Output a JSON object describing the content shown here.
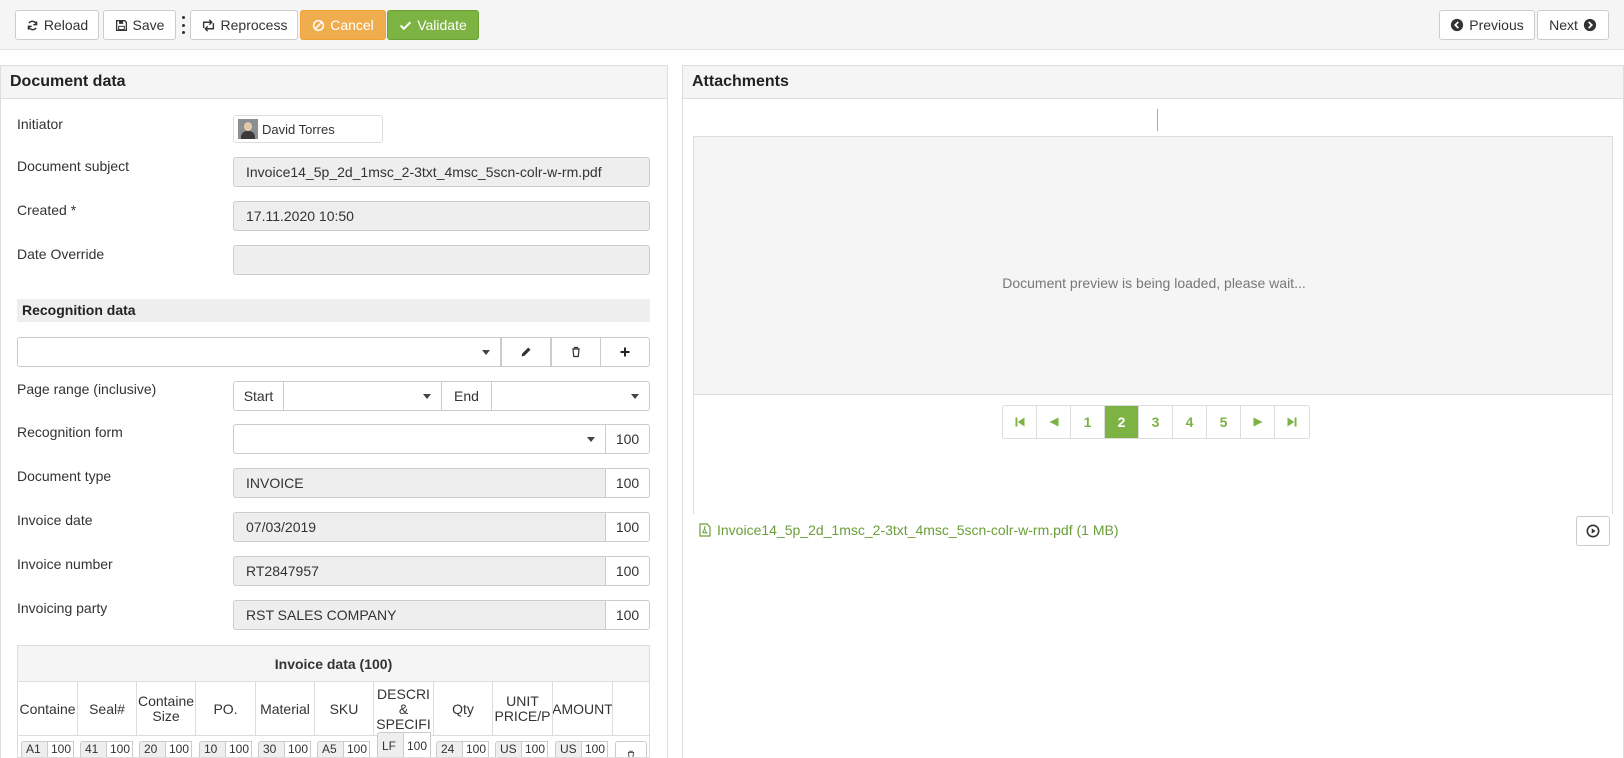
{
  "toolbar": {
    "reload": "Reload",
    "save": "Save",
    "reprocess": "Reprocess",
    "cancel": "Cancel",
    "validate": "Validate",
    "previous": "Previous",
    "next": "Next"
  },
  "document_data": {
    "title": "Document data",
    "initiator_label": "Initiator",
    "initiator": "David Torres",
    "subject_label": "Document subject",
    "subject": "Invoice14_5p_2d_1msc_2-3txt_4msc_5scn-colr-w-rm.pdf",
    "created_label": "Created",
    "created_required": "*",
    "created": "17.11.2020 10:50",
    "date_override_label": "Date Override",
    "date_override": ""
  },
  "recognition": {
    "title": "Recognition data",
    "page_range_label": "Page range (inclusive)",
    "start": "Start",
    "end": "End",
    "form_label": "Recognition form",
    "form_score": "100",
    "fields": [
      {
        "label": "Document type",
        "value": "INVOICE",
        "score": "100"
      },
      {
        "label": "Invoice date",
        "value": "07/03/2019",
        "score": "100"
      },
      {
        "label": "Invoice number",
        "value": "RT2847957",
        "score": "100"
      },
      {
        "label": "Invoicing party",
        "value": "RST SALES COMPANY",
        "score": "100"
      }
    ]
  },
  "invoice_grid": {
    "title": "Invoice data (100)",
    "columns": [
      "Containe",
      "Seal#",
      "Containe Size",
      "PO.",
      "Material",
      "SKU",
      "DESCRI & SPECIFI",
      "Qty",
      "UNIT PRICE/P",
      "AMOUNT"
    ],
    "row": [
      {
        "v": "A1",
        "s": "100"
      },
      {
        "v": "41",
        "s": "100"
      },
      {
        "v": "20",
        "s": "100"
      },
      {
        "v": "10",
        "s": "100"
      },
      {
        "v": "30",
        "s": "100"
      },
      {
        "v": "A5",
        "s": "100"
      },
      {
        "v": "LF",
        "s": "100"
      },
      {
        "v": "24",
        "s": "100"
      },
      {
        "v": "US",
        "s": "100"
      },
      {
        "v": "US",
        "s": "100"
      }
    ]
  },
  "attachments": {
    "title": "Attachments",
    "loading": "Document preview is being loaded, please wait...",
    "pages": [
      "1",
      "2",
      "3",
      "4",
      "5"
    ],
    "active_page": "2",
    "file": "Invoice14_5p_2d_1msc_2-3txt_4msc_5scn-colr-w-rm.pdf (1 MB)"
  },
  "colors": {
    "accent": "#7cb342",
    "warning": "#f0ad4e",
    "link": "#6a9f3a"
  }
}
